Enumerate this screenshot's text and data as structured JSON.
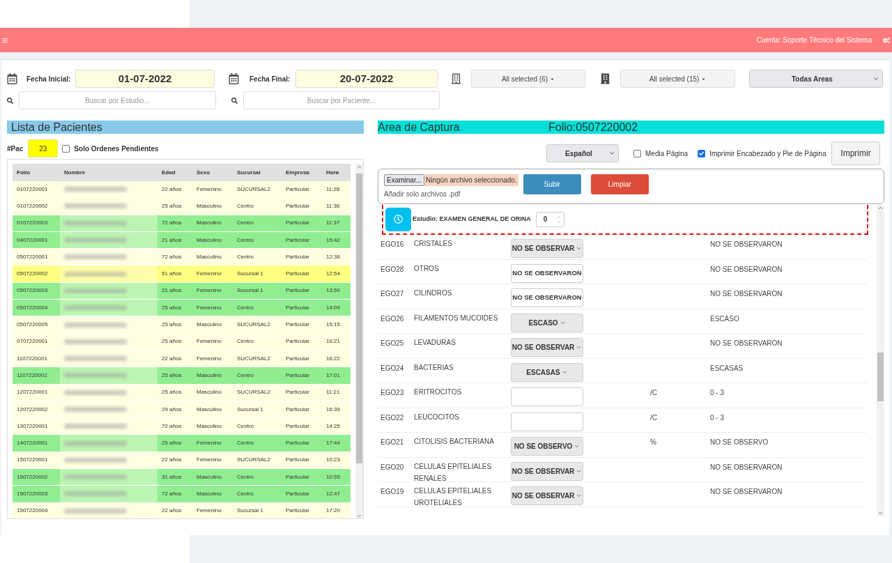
{
  "navbar": {
    "account": "Cuenta: Soporte Técnico del Sistema"
  },
  "filters": {
    "start_date": {
      "label": "Fecha Inicial:",
      "value": "01-07-2022"
    },
    "end_date": {
      "label": "Fecha Final:",
      "value": "20-07-2022"
    },
    "branch_dropdown": "All selected (6)",
    "company_dropdown": "All selected (15)",
    "area_select": "Todas Areas",
    "study_search": {
      "placeholder": "Buscar por Estudio..."
    },
    "patient_search": {
      "placeholder": "Buscar por Paciente..."
    }
  },
  "patient_list": {
    "title": "Lista de Pacientes",
    "count_label": "#Pac",
    "count": "23",
    "pending_filter": {
      "label": "Solo Ordenes Pendientes",
      "checked": false
    },
    "columns": [
      "Folio",
      "Nombre",
      "Edad",
      "Sexo",
      "Sucursal",
      "Empresa",
      "Hora"
    ],
    "rows": [
      {
        "folio": "0107220001",
        "edad": "22 años",
        "sexo": "Femenino",
        "sucursal": "SUCURSAL2",
        "empresa": "Particular",
        "hora": "11:26",
        "completed": false,
        "selected": false
      },
      {
        "folio": "0107220002",
        "edad": "25 años",
        "sexo": "Masculino",
        "sucursal": "Centro",
        "empresa": "Particular",
        "hora": "11:36",
        "completed": false,
        "selected": false
      },
      {
        "folio": "0107220003",
        "edad": "72 años",
        "sexo": "Masculino",
        "sucursal": "Centro",
        "empresa": "Particular",
        "hora": "11:37",
        "completed": true,
        "selected": false
      },
      {
        "folio": "0407220001",
        "edad": "21 años",
        "sexo": "Masculino",
        "sucursal": "Centro",
        "empresa": "Particular",
        "hora": "15:42",
        "completed": true,
        "selected": false
      },
      {
        "folio": "0507220001",
        "edad": "72 años",
        "sexo": "Masculino",
        "sucursal": "Centro",
        "empresa": "Particular",
        "hora": "12:36",
        "completed": false,
        "selected": false
      },
      {
        "folio": "0507220002",
        "edad": "51 años",
        "sexo": "Femenino",
        "sucursal": "Sucursal 1",
        "empresa": "Particular",
        "hora": "12:54",
        "selected": true
      },
      {
        "folio": "0507220003",
        "edad": "21 años",
        "sexo": "Femenino",
        "sucursal": "Sucursal 1",
        "empresa": "Particular",
        "hora": "13:50",
        "completed": true,
        "selected": false
      },
      {
        "folio": "0507220004",
        "edad": "25 años",
        "sexo": "Femenino",
        "sucursal": "Centro",
        "empresa": "Particular",
        "hora": "14:09",
        "completed": true,
        "selected": false
      },
      {
        "folio": "0507220005",
        "edad": "25 años",
        "sexo": "Masculino",
        "sucursal": "SUCURSAL2",
        "empresa": "Particular",
        "hora": "15:15",
        "completed": false,
        "selected": false
      },
      {
        "folio": "0707220001",
        "edad": "25 años",
        "sexo": "Femenino",
        "sucursal": "Centro",
        "empresa": "Particular",
        "hora": "16:21",
        "completed": false,
        "selected": false
      },
      {
        "folio": "1107220001",
        "edad": "22 años",
        "sexo": "Femenino",
        "sucursal": "SUCURSAL2",
        "empresa": "Particular",
        "hora": "16:22",
        "completed": false,
        "selected": false
      },
      {
        "folio": "1107220002",
        "edad": "25 años",
        "sexo": "Masculino",
        "sucursal": "Centro",
        "empresa": "Particular",
        "hora": "17:01",
        "completed": true,
        "selected": false
      },
      {
        "folio": "1207220001",
        "edad": "25 años",
        "sexo": "Masculino",
        "sucursal": "SUCURSAL2",
        "empresa": "Particular",
        "hora": "11:21",
        "completed": false,
        "selected": false
      },
      {
        "folio": "1207220002",
        "edad": "29 años",
        "sexo": "Masculino",
        "sucursal": "Sucursal 1",
        "empresa": "Particular",
        "hora": "16:39",
        "completed": false,
        "selected": false
      },
      {
        "folio": "1307220001",
        "edad": "72 años",
        "sexo": "Masculino",
        "sucursal": "Centro",
        "empresa": "Particular",
        "hora": "14:25",
        "completed": false,
        "selected": false
      },
      {
        "folio": "1407220001",
        "edad": "25 años",
        "sexo": "Femenino",
        "sucursal": "Centro",
        "empresa": "Particular",
        "hora": "17:44",
        "completed": true,
        "selected": false
      },
      {
        "folio": "1507220001",
        "edad": "22 años",
        "sexo": "Femenino",
        "sucursal": "SUCURSAL2",
        "empresa": "Particular",
        "hora": "10:23",
        "completed": false,
        "selected": false
      },
      {
        "folio": "1507220002",
        "edad": "31 años",
        "sexo": "Masculino",
        "sucursal": "Centro",
        "empresa": "Particular",
        "hora": "10:55",
        "completed": true,
        "selected": false
      },
      {
        "folio": "1507220003",
        "edad": "72 años",
        "sexo": "Masculino",
        "sucursal": "Centro",
        "empresa": "Particular",
        "hora": "12:47",
        "completed": true,
        "selected": false
      },
      {
        "folio": "1507220004",
        "edad": "22 años",
        "sexo": "Femenino",
        "sucursal": "Sucursal 1",
        "empresa": "Particular",
        "hora": "17:20",
        "completed": false,
        "selected": false
      }
    ]
  },
  "capture": {
    "title": "Area de Captura",
    "folio": "Folio:0507220002",
    "language_select": "Español",
    "half_page": {
      "label": "Media Página",
      "checked": false
    },
    "print_header": {
      "label": "Imprimir Encabezado y Pie de Página",
      "checked": true
    },
    "print_button": "Imprimir",
    "upload": {
      "browse_button": "Examinar...",
      "file_status": "Ningún archivo seleccionado.",
      "hint": "Añadir solo archivos .pdf",
      "upload_button": "Subir",
      "clear_button": "Limpiar"
    },
    "study": {
      "label": "Estudio: EXAMEN GENERAL DE ORINA",
      "value": "0"
    },
    "tests": [
      {
        "code": "EGO16",
        "name": "CRISTALES",
        "kind": "select",
        "value": "NO SE OBSERVAR",
        "reference": "NO SE OBSERVARON"
      },
      {
        "code": "EGO28",
        "name": "OTROS",
        "kind": "text",
        "value": "NO SE OBSERVARON",
        "reference": "NO SE OBSERVARON"
      },
      {
        "code": "EGO27",
        "name": "CILINDROS",
        "kind": "text",
        "value": "NO SE OBSERVARON",
        "reference": "NO SE OBSERVARON"
      },
      {
        "code": "EGO26",
        "name": "FILAMENTOS MUCOIDES",
        "kind": "select",
        "value": "ESCASO",
        "reference": "ESCASO"
      },
      {
        "code": "EGO25",
        "name": "LEVADURAS",
        "kind": "select",
        "value": "NO SE OBSERVAR",
        "reference": "NO SE OBSERVARON"
      },
      {
        "code": "EGO24",
        "name": "BACTERIAS",
        "kind": "select",
        "value": "ESCASAS",
        "reference": "ESCASAS"
      },
      {
        "code": "EGO23",
        "name": "ERITROCITOS",
        "kind": "text",
        "unit": "/C",
        "reference": "0 - 3"
      },
      {
        "code": "EGO22",
        "name": "LEUCOCITOS",
        "kind": "text",
        "unit": "/C",
        "reference": "0 - 3"
      },
      {
        "code": "EGO21",
        "name": "CITOLISIS BACTERIANA",
        "kind": "select",
        "value": "NO SE OBSERVO",
        "unit": "%",
        "reference": "NO SE OBSERVO"
      },
      {
        "code": "EGO20",
        "name": "CELULAS EPITELIALES RENALES",
        "kind": "select",
        "value": "NO SE OBSERVAR",
        "reference": "NO SE OBSERVARON"
      },
      {
        "code": "EGO19",
        "name": "CELULAS EPITELIALES UROTELIALES",
        "kind": "select",
        "value": "NO SE OBSERVAR",
        "reference": "NO SE OBSERVARON"
      }
    ]
  }
}
